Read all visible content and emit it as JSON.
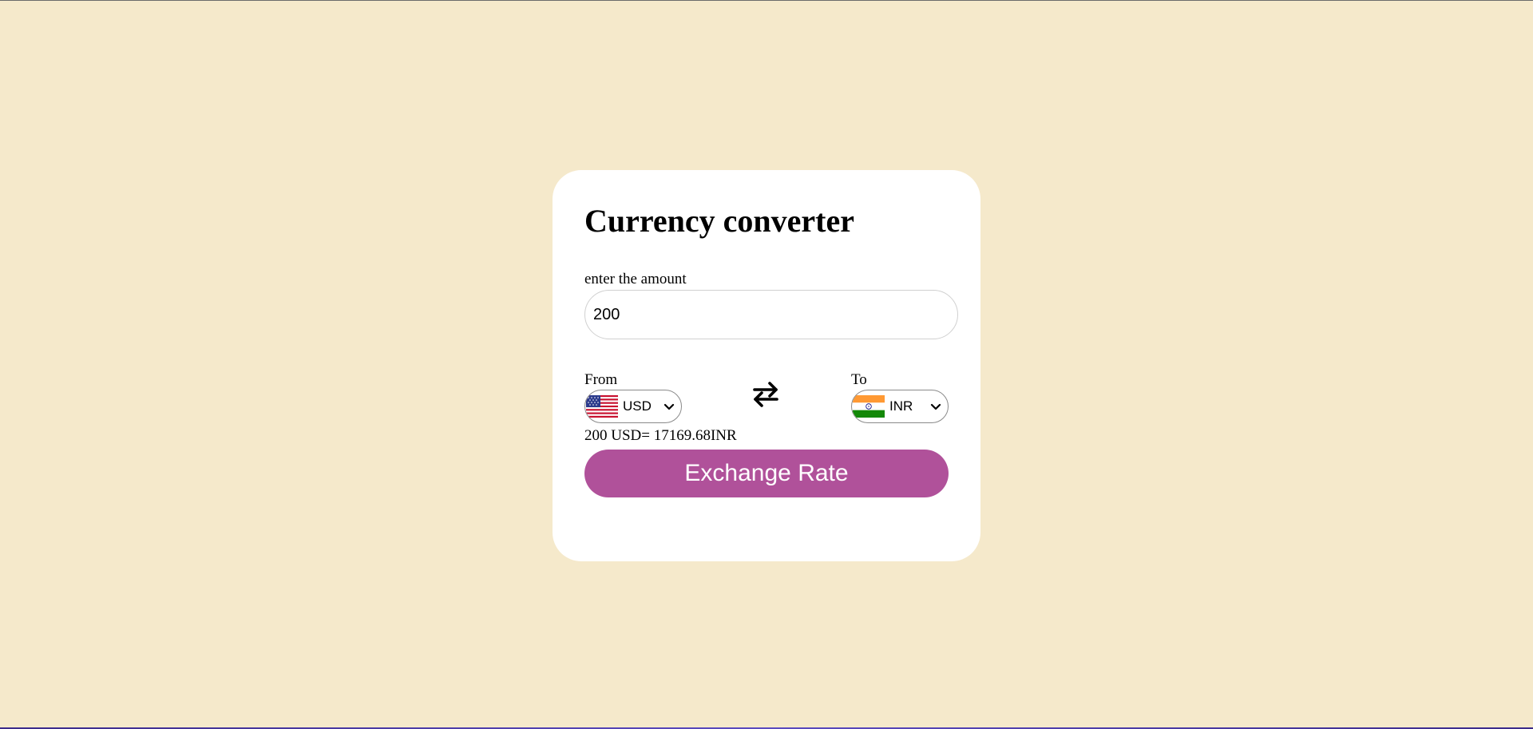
{
  "page": {
    "background_color": "#f5e9cb"
  },
  "converter": {
    "title": "Currency converter",
    "amount_label": "enter the amount",
    "amount_value": "200",
    "from_label": "From",
    "from_currency": "USD",
    "from_flag_icon": "us-flag-icon",
    "to_label": "To",
    "to_currency": "INR",
    "to_flag_icon": "india-flag-icon",
    "swap_icon": "swap-arrows-icon",
    "result_text": "200 USD= 17169.68INR",
    "button_label": "Exchange Rate",
    "button_color": "#b0519a"
  }
}
